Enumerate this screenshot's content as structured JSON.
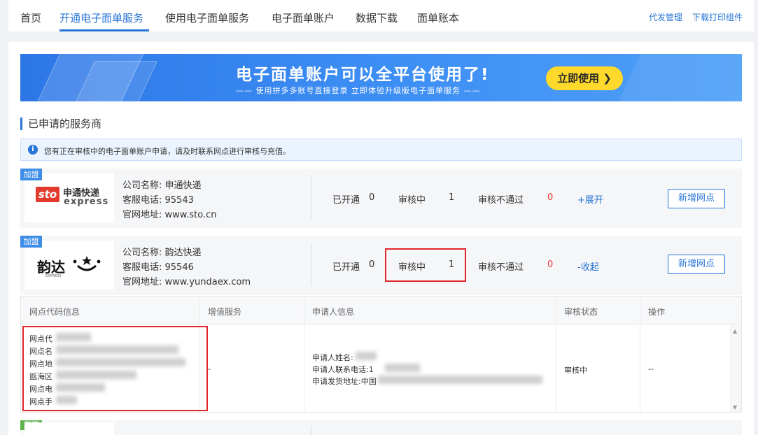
{
  "nav": {
    "tabs": [
      "首页",
      "开通电子面单服务",
      "使用电子面单服务",
      "电子面单账户",
      "数据下载",
      "面单账本"
    ],
    "right_links": [
      "代发管理",
      "下载打印组件"
    ]
  },
  "banner": {
    "headline": "电子面单账户可以全平台使用了!",
    "subline": "—— 使用拼多多账号直接登录 立即体验升级版电子面单服务 ——",
    "cta": "立即使用 ❯"
  },
  "section_title": "已申请的服务商",
  "notice": {
    "icon": "info-icon",
    "text": "您有正在审核中的电子面单账户申请，请及时联系网点进行审核与充值。"
  },
  "providers": [
    {
      "badge": "加盟",
      "logo": {
        "mark": "sto",
        "cn": "申通快递",
        "en": "express"
      },
      "company": "公司名称:  申通快递",
      "phone": "客服电话:  95543",
      "site": "官网地址:  www.sto.cn",
      "opened_label": "已开通",
      "opened": "0",
      "reviewing_label": "审核中",
      "reviewing": "1",
      "rejected_label": "审核不通过",
      "rejected": "0",
      "toggle": "+展开",
      "add_button": "新增网点"
    },
    {
      "badge": "加盟",
      "logo": {
        "cn": "韵达",
        "small": "EXPRESS"
      },
      "company": "公司名称:  韵达快递",
      "phone": "客服电话:  95546",
      "site": "官网地址:  www.yundaex.com",
      "opened_label": "已开通",
      "opened": "0",
      "reviewing_label": "审核中",
      "reviewing": "1",
      "rejected_label": "审核不通过",
      "rejected": "0",
      "toggle": "-收起",
      "add_button": "新增网点"
    }
  ],
  "table": {
    "headers": [
      "网点代码信息",
      "增值服务",
      "申请人信息",
      "审核状态",
      "操作"
    ],
    "row": {
      "outlet_lines": [
        "网点代",
        "网点名",
        "网点地",
        "瓯海区",
        "网点电",
        "网点手"
      ],
      "value_added": "-",
      "applicant_lines": [
        "申请人姓名:",
        "申请人联系电话:1",
        "申请发货地址:中国"
      ],
      "status": "审核中",
      "action": "--"
    }
  },
  "bottom_badge": "直营",
  "colors": {
    "accent": "#2775d6",
    "danger": "#e53935",
    "highlight_box": "#e0262c",
    "cta": "#ffd92c"
  }
}
